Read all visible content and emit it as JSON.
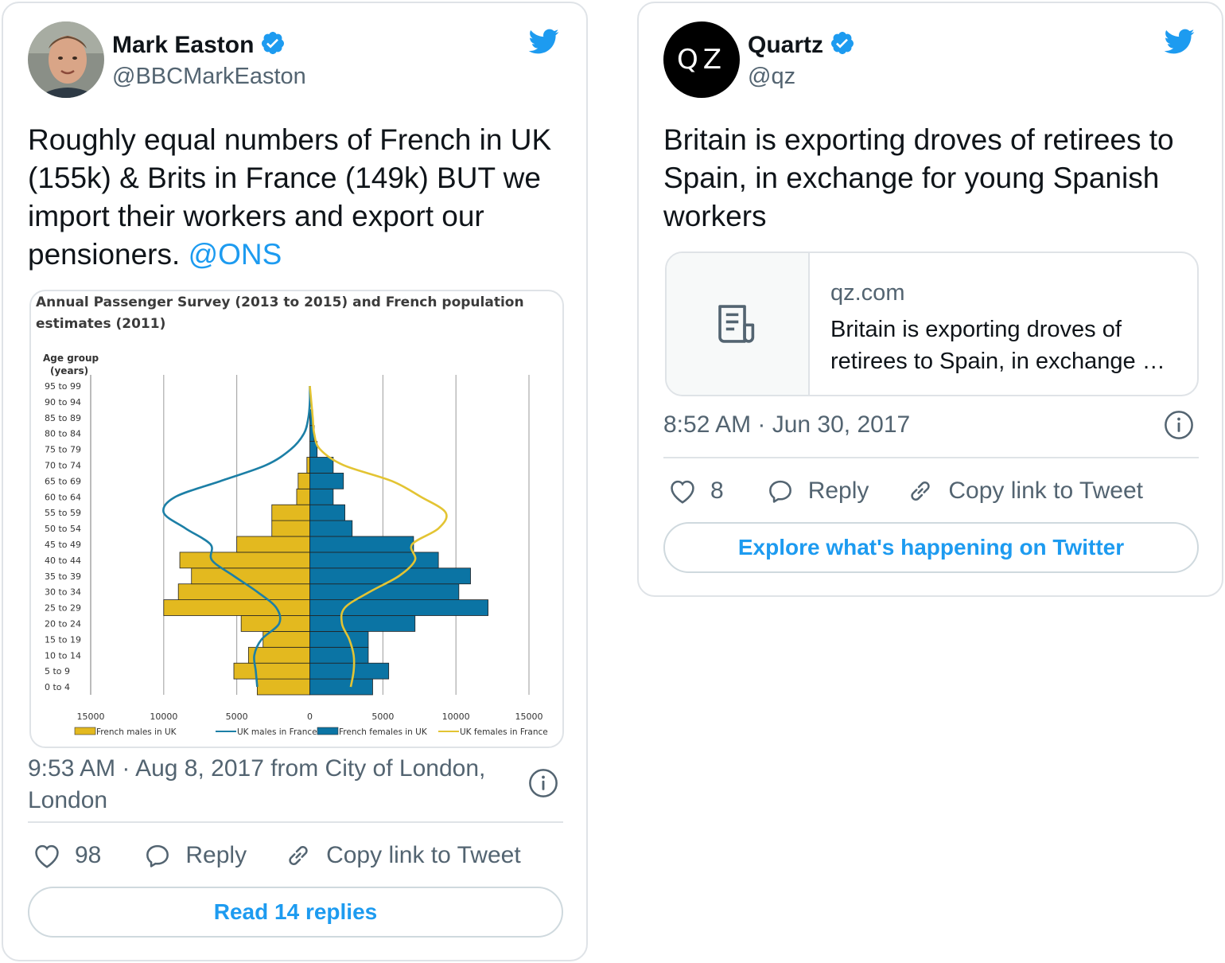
{
  "colors": {
    "accent": "#1d9bf0",
    "text": "#0f1419",
    "muted": "#536471",
    "border": "#dfe3e7",
    "yellow": "#e3b91f",
    "blue": "#0b74a4"
  },
  "tweet1": {
    "name": "Mark Easton",
    "handle": "@BBCMarkEaston",
    "text_main": "Roughly equal numbers of French in UK (155k) & Brits in France (149k) BUT we import their workers and export our pensioners.",
    "mention": "@ONS",
    "meta_line1": "9:53 AM · Aug 8, 2017 from City of London,",
    "meta_line2": "London",
    "likes": "98",
    "reply_label": "Reply",
    "copy_label": "Copy link to Tweet",
    "button_label": "Read 14 replies"
  },
  "tweet2": {
    "name": "Quartz",
    "handle": "@qz",
    "avatar_text": "QZ",
    "text_main": "Britain is exporting droves of retirees to Spain, in exchange for young Spanish workers",
    "link_domain": "qz.com",
    "link_title_1": "Britain is exporting droves of",
    "link_title_2": "retirees to Spain, in exchange …",
    "meta": "8:52 AM · Jun 30, 2017",
    "likes": "8",
    "reply_label": "Reply",
    "copy_label": "Copy link to Tweet",
    "button_label": "Explore what's happening on Twitter"
  },
  "icons": {
    "verified": "verified-badge-icon",
    "bird": "twitter-bird-icon",
    "heart": "heart-icon",
    "reply": "reply-bubble-icon",
    "link": "link-icon",
    "info": "info-icon",
    "article": "article-icon"
  },
  "chart_data": {
    "type": "bar",
    "orientation": "horizontal-population-pyramid",
    "title": "Annual Passenger Survey (2013 to 2015) and French population estimates (2011)",
    "ylabel_1": "Age group",
    "ylabel_2": "(years)",
    "categories": [
      "0 to 4",
      "5 to 9",
      "10 to 14",
      "15 to 19",
      "20 to 24",
      "25 to 29",
      "30 to 34",
      "35 to 39",
      "40 to 44",
      "45 to 49",
      "50 to 54",
      "55 to 59",
      "60 to 64",
      "65 to 69",
      "70 to 74",
      "75 to 79",
      "80 to 84",
      "85 to 89",
      "90 to 94",
      "95 to 99"
    ],
    "xlim": [
      -15000,
      15000
    ],
    "x_ticks": [
      -15000,
      -10000,
      -5000,
      0,
      5000,
      10000,
      15000
    ],
    "x_tick_labels": [
      "15000",
      "10000",
      "5000",
      "0",
      "5000",
      "10000",
      "15000"
    ],
    "series": [
      {
        "name": "French males in UK",
        "kind": "bar",
        "side": "left",
        "color": "#e3b91f",
        "values": [
          3600,
          5200,
          4200,
          3200,
          4700,
          10000,
          9000,
          8100,
          8900,
          5000,
          2600,
          2600,
          900,
          800,
          200,
          0,
          0,
          0,
          0,
          0
        ]
      },
      {
        "name": "UK males in France",
        "kind": "line",
        "side": "left",
        "color": "#1c7fa6",
        "values": [
          3600,
          3700,
          3800,
          3300,
          2100,
          2300,
          3600,
          5200,
          6700,
          6800,
          8500,
          10000,
          9200,
          6100,
          3000,
          1300,
          400,
          100,
          0,
          0
        ]
      },
      {
        "name": "French females in UK",
        "kind": "bar",
        "side": "right",
        "color": "#0b74a4",
        "values": [
          4300,
          5400,
          4000,
          4000,
          7200,
          12200,
          10200,
          11000,
          8800,
          7100,
          2900,
          2400,
          1600,
          2300,
          1600,
          500,
          300,
          200,
          0,
          0
        ]
      },
      {
        "name": "UK females in France",
        "kind": "line",
        "side": "right",
        "color": "#e3c433",
        "values": [
          2800,
          3000,
          3000,
          2700,
          2200,
          2400,
          4100,
          6100,
          7200,
          7000,
          8800,
          9300,
          7600,
          5600,
          2300,
          700,
          300,
          200,
          100,
          0
        ]
      }
    ],
    "legend_position": "bottom",
    "grid": true
  }
}
